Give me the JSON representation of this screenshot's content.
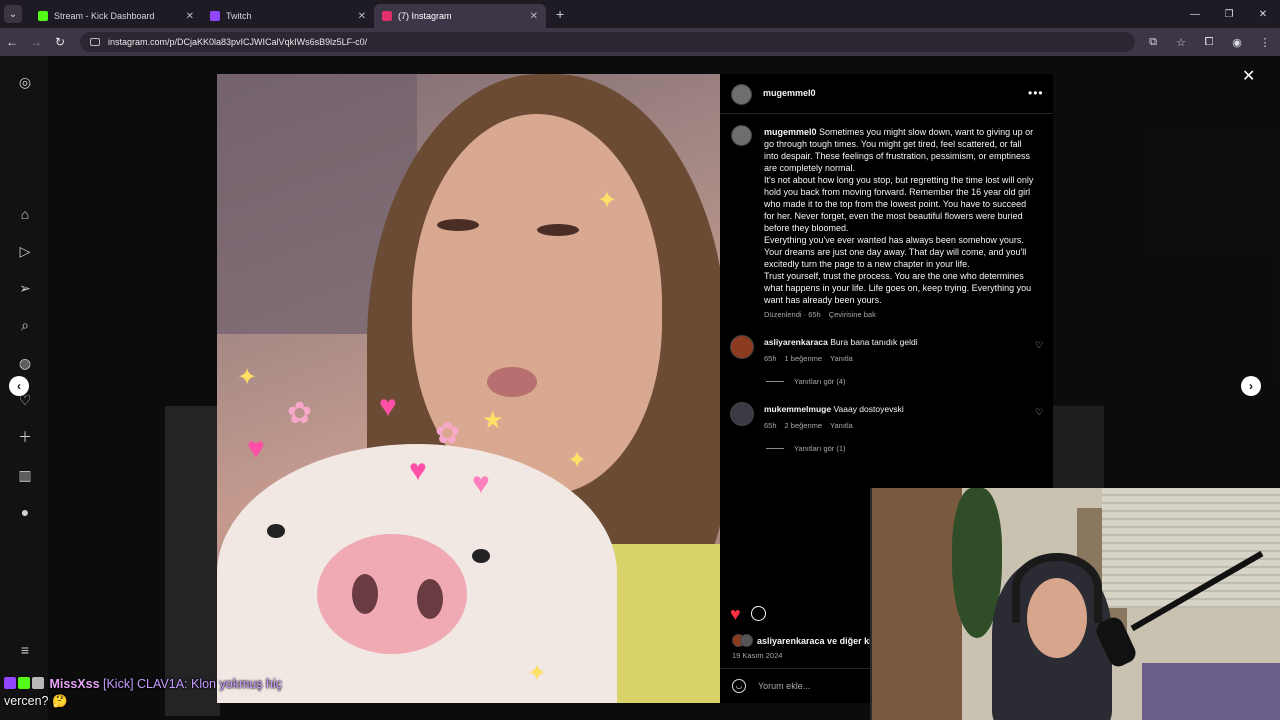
{
  "browser": {
    "tabs": [
      {
        "title": "Stream - Kick Dashboard",
        "favicon_color": "#53fc18",
        "active": false
      },
      {
        "title": "Twitch",
        "favicon_color": "#9146ff",
        "active": false
      },
      {
        "title": "(7) Instagram",
        "favicon_color": "#e1306c",
        "active": true
      }
    ],
    "new_tab": "+",
    "url": "instagram.com/p/DCjaKK0la83pvICJWICalVqkIWs6sB9lz5LF-c0/"
  },
  "sidebar": {
    "icons": [
      "instagram-icon",
      "home-icon",
      "reels-icon",
      "direct-icon",
      "search-icon",
      "explore-icon",
      "notifications-icon",
      "create-icon",
      "dashboard-icon",
      "profile-icon",
      "menu-icon"
    ],
    "notification_count": "7"
  },
  "post": {
    "author": "mugemmel0",
    "caption": {
      "author": "mugemmel0",
      "paragraphs": [
        "Sometimes you might slow down, want to giving up or go through tough times. You might get tired, feel scattered, or fall into despair. These feelings of frustration, pessimism, or emptiness are completely normal.",
        "It's not about how long you stop, but regretting the time lost will only hold you back from moving forward. Remember the 16 year old girl who made it to the top from the lowest point. You have to succeed for her. Never forget, even the most beautiful flowers were buried before they bloomed.",
        "Everything you've ever wanted has always been somehow yours. Your dreams are just one day away. That day will come, and you'll excitedly turn the page to a new chapter in your life.",
        "Trust yourself, trust the process. You are the one who determines what happens in your life. Life goes on, keep trying. Everything you want has already been yours."
      ],
      "edited": "Düzenlendi · 65h",
      "translate": "Çevirisine bak"
    },
    "comments": [
      {
        "user": "asliyarenkaraca",
        "text": "Bura bana tanıdık geldi",
        "time": "65h",
        "likes": "1 beğenme",
        "reply": "Yanıtla",
        "view_replies": "Yanıtları gör (4)"
      },
      {
        "user": "mukemmelmuge",
        "text": "Vaaay dostoyevski",
        "time": "65h",
        "likes": "2 beğenme",
        "reply": "Yanıtla",
        "view_replies": "Yanıtları gör (1)"
      }
    ],
    "liked_by": "asliyarenkaraca ve diğer ki",
    "date": "19 Kasım 2024",
    "comment_placeholder": "Yorum ekle..."
  },
  "chat": {
    "username": "MissXss",
    "message": "[Kick] CLAV1A: Klon yokmuş hiç",
    "message_cont": "vercen? 🤔"
  },
  "colors": {
    "like": "#ff3040",
    "chat_name": "#e7a3f5",
    "tab_active": "#3d3647"
  }
}
